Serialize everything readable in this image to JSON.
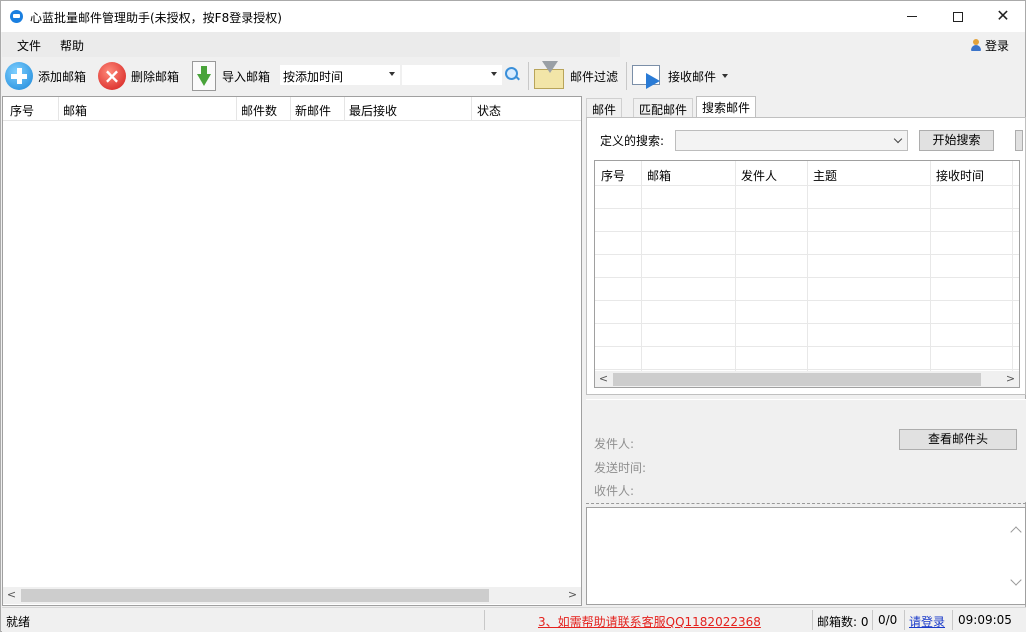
{
  "window": {
    "title": "心蓝批量邮件管理助手(未授权，按F8登录授权)",
    "minimize_label": "",
    "close_label": "✕"
  },
  "menu": {
    "file": "文件",
    "help": "帮助",
    "login": "登录"
  },
  "toolbar": {
    "add_mailbox": "添加邮箱",
    "delete_mailbox": "删除邮箱",
    "import_mailbox": "导入邮箱",
    "sort_value": "按添加时间",
    "filter_value": "",
    "mail_filter": "邮件过滤",
    "receive_mail": "接收邮件",
    "icons": [
      "add-icon",
      "delete-icon",
      "import-icon",
      "search-icon",
      "mail-filter-icon",
      "receive-mail-icon"
    ]
  },
  "mailbox_list": {
    "columns": [
      "序号",
      "邮箱",
      "邮件数",
      "新邮件",
      "最后接收",
      "状态"
    ],
    "rows": []
  },
  "right_panel": {
    "tabs": [
      "邮件",
      "匹配邮件",
      "搜索邮件"
    ],
    "active_tab": "搜索邮件",
    "search_label": "定义的搜索:",
    "search_value": "",
    "start_search": "开始搜索",
    "result_columns": [
      "序号",
      "邮箱",
      "发件人",
      "主题",
      "接收时间"
    ],
    "result_rows": []
  },
  "mail_header": {
    "view_header_button": "查看邮件头",
    "sender_label": "发件人:",
    "send_time_label": "发送时间:",
    "recipient_label": "收件人:"
  },
  "statusbar": {
    "status": "就绪",
    "notice": "3、如需帮助请联系客服QQ1182022368",
    "mailbox_count": "邮箱数: 0",
    "ratio": "0/0",
    "login_link": "请登录",
    "time": "09:09:05"
  },
  "colors": {
    "notice_red": "#e4211d",
    "link_blue": "#1a3ac9",
    "accent_blue": "#1a86d8"
  }
}
